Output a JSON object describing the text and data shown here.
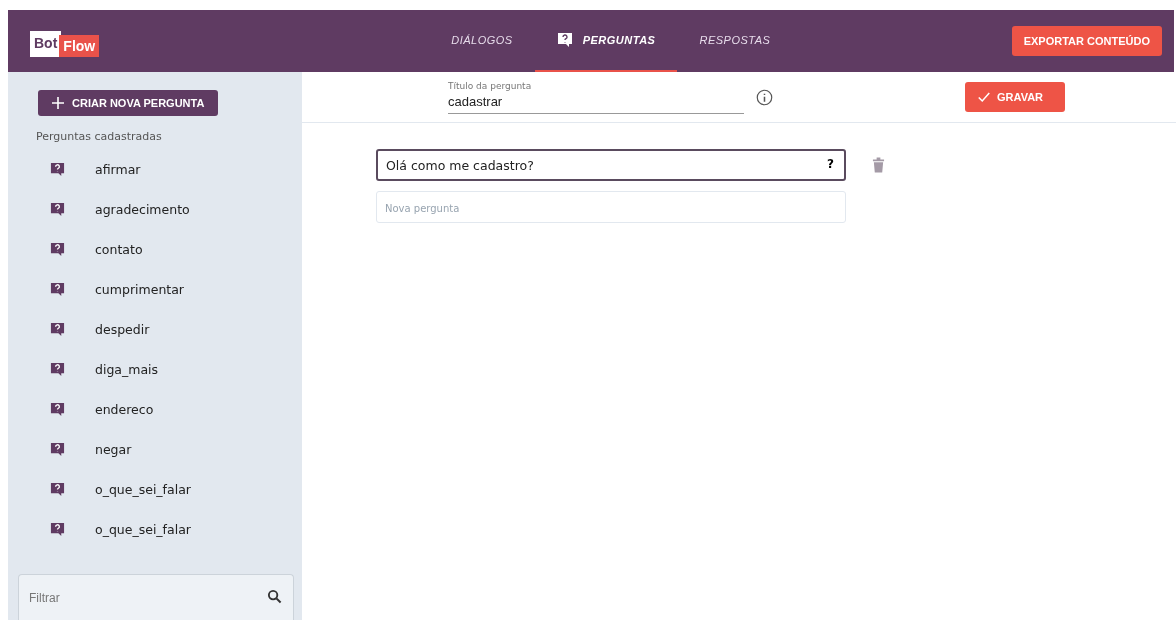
{
  "logo": {
    "part_1": "Bot",
    "part_2": "Flow"
  },
  "tabs": [
    {
      "label": "DIÁLOGOS",
      "selected": false
    },
    {
      "label": "PERGUNTAS",
      "selected": true
    },
    {
      "label": "RESPOSTAS",
      "selected": false
    }
  ],
  "export_button": "EXPORTAR CONTEÚDO",
  "sidebar": {
    "create_button": "CRIAR NOVA PERGUNTA",
    "heading": "Perguntas cadastradas",
    "items": [
      {
        "label": "afirmar"
      },
      {
        "label": "agradecimento"
      },
      {
        "label": "contato"
      },
      {
        "label": "cumprimentar"
      },
      {
        "label": "despedir"
      },
      {
        "label": "diga_mais"
      },
      {
        "label": "endereco"
      },
      {
        "label": "negar"
      },
      {
        "label": "o_que_sei_falar"
      },
      {
        "label": "o_que_sei_falar"
      }
    ],
    "filter": {
      "placeholder": "Filtrar"
    }
  },
  "title_field": {
    "label": "Título da pergunta",
    "value": "cadastrar"
  },
  "save_button": "GRAVAR",
  "questions": [
    {
      "value": "Olá como me cadastro?",
      "suffix": "?",
      "focused": true
    }
  ],
  "new_question": {
    "placeholder": "Nova pergunta"
  }
}
